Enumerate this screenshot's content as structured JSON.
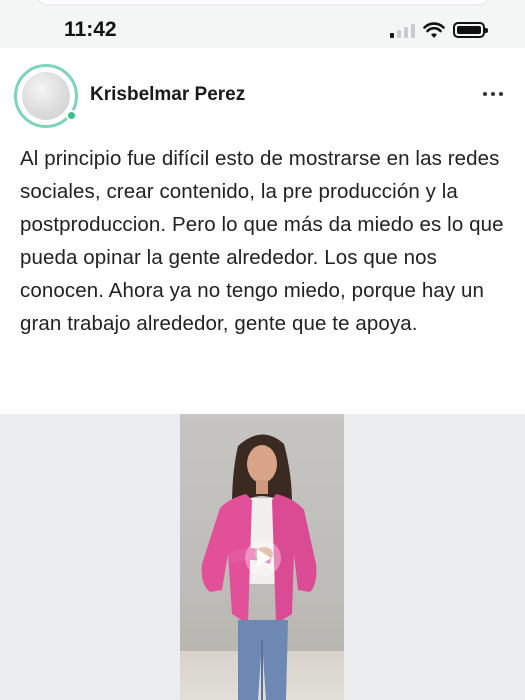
{
  "status_bar": {
    "time": "11:42",
    "signal_icon": "cellular-signal-icon",
    "wifi_icon": "wifi-icon",
    "battery_icon": "battery-icon"
  },
  "post": {
    "author": {
      "name": "Krisbelmar Perez",
      "avatar_icon": "avatar-placeholder",
      "online": true
    },
    "menu_icon": "more-horizontal-icon",
    "text": "Al principio fue difícil esto de mostrarse en las redes sociales, crear contenido, la pre producción y la postproduccion. Pero lo que más da miedo es lo que pueda opinar la gente alrededor. Los que nos conocen. Ahora ya no tengo miedo, porque hay un gran trabajo alrededor, gente que te apoya.",
    "media": {
      "type": "video",
      "play_icon": "play-icon"
    }
  },
  "colors": {
    "accent_blue": "#1f7ae8",
    "avatar_ring": "#7fd3b9",
    "online_dot": "#3bbf8f",
    "media_background": "#ecedef"
  }
}
